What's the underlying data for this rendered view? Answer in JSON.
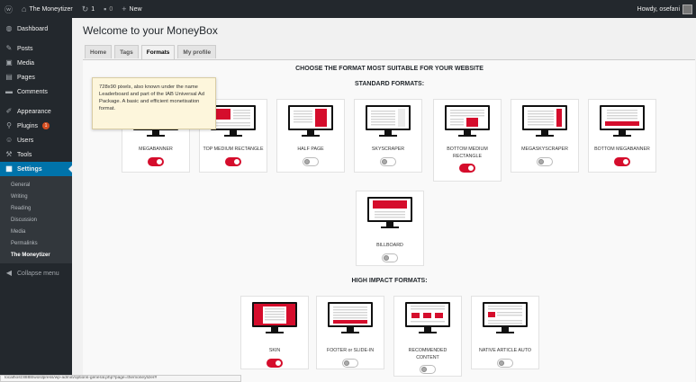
{
  "adminbar": {
    "site_name": "The Moneytizer",
    "updates": "1",
    "comments": "0",
    "new_label": "New",
    "greeting": "Howdy, osefani"
  },
  "sidebar": {
    "items": [
      {
        "label": "Dashboard",
        "icon": "dashboard-icon"
      },
      {
        "label": "Posts",
        "icon": "pin-icon"
      },
      {
        "label": "Media",
        "icon": "media-icon"
      },
      {
        "label": "Pages",
        "icon": "pages-icon"
      },
      {
        "label": "Comments",
        "icon": "comments-icon"
      },
      {
        "label": "Appearance",
        "icon": "brush-icon"
      },
      {
        "label": "Plugins",
        "icon": "plugin-icon",
        "badge": "1"
      },
      {
        "label": "Users",
        "icon": "users-icon"
      },
      {
        "label": "Tools",
        "icon": "wrench-icon"
      },
      {
        "label": "Settings",
        "icon": "settings-icon"
      }
    ],
    "submenu": [
      "General",
      "Writing",
      "Reading",
      "Discussion",
      "Media",
      "Permalinks",
      "The Moneytizer"
    ],
    "collapse": "Collapse menu"
  },
  "page": {
    "title": "Welcome to your MoneyBox",
    "tabs": [
      "Home",
      "Tags",
      "Formats",
      "My profile"
    ],
    "active_tab": "Formats"
  },
  "formats": {
    "main_heading": "CHOOSE THE FORMAT MOST SUITABLE FOR YOUR WEBSITE",
    "standard_heading": "STANDARD FORMATS:",
    "high_impact_heading": "HIGH IMPACT FORMATS:",
    "standard": [
      {
        "label": "MEGABANNER",
        "enabled": true
      },
      {
        "label": "TOP MEDIUM RECTANGLE",
        "enabled": true
      },
      {
        "label": "HALF PAGE",
        "enabled": false
      },
      {
        "label": "SKYSCRAPER",
        "enabled": false
      },
      {
        "label": "BOTTOM MEDIUM RECTANGLE",
        "enabled": true
      },
      {
        "label": "MEGASKYSCRAPER",
        "enabled": false
      },
      {
        "label": "BOTTOM MEGABANNER",
        "enabled": true
      },
      {
        "label": "BILLBOARD",
        "enabled": false
      }
    ],
    "high_impact": [
      {
        "label": "SKIN",
        "enabled": true
      },
      {
        "label": "FOOTER or SLIDE-IN",
        "enabled": false
      },
      {
        "label": "RECOMMENDED CONTENT",
        "enabled": false
      },
      {
        "label": "NATIVE ARTICLE AUTO",
        "enabled": false
      }
    ],
    "tooltip": "728x90 pixels, also known under the name Leaderboard and part of the IAB Universal Ad Package. A basic and efficient monetisation format."
  },
  "statusbar": {
    "url": "localhost:8888/wordpress/wp-admin/options-general.php?page=themoneytizer#"
  },
  "colors": {
    "accent": "#d50d2c",
    "wp_blue": "#0073aa",
    "admin_dark": "#23282d"
  }
}
